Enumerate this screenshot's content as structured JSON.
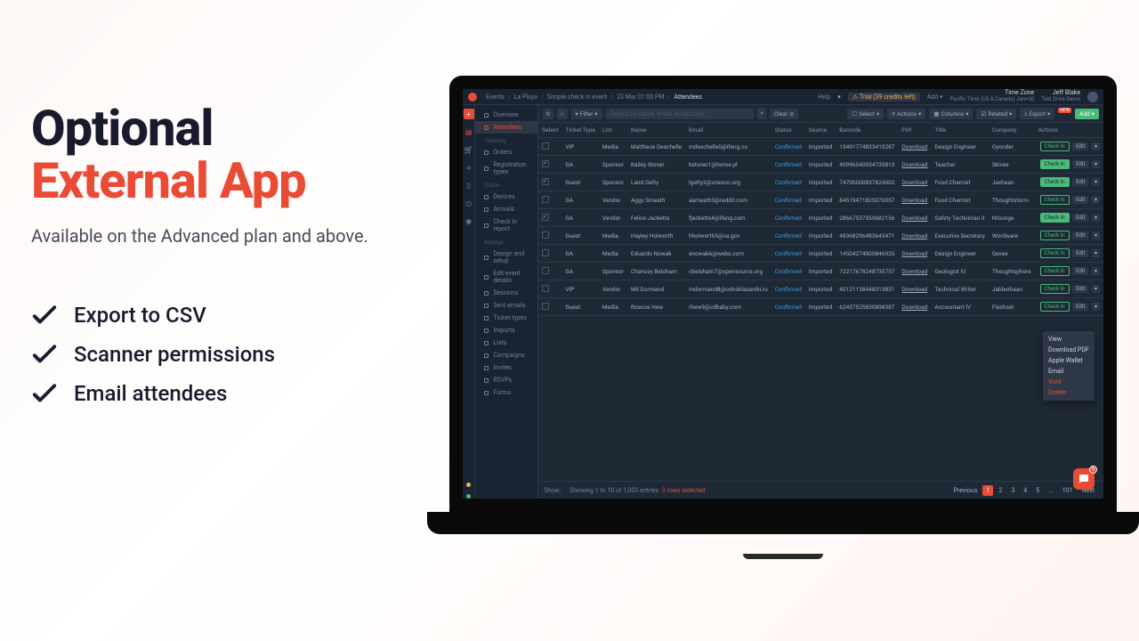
{
  "marketing": {
    "heading1": "Optional",
    "heading2": "External App",
    "subline": "Available on the Advanced plan and above.",
    "features": [
      "Export to CSV",
      "Scanner permissions",
      "Email attendees"
    ]
  },
  "breadcrumb": [
    "Events",
    "La Playa",
    "Simple check in event",
    "23 Mar 01:00 PM",
    "Attendees"
  ],
  "topbar": {
    "help": "Help",
    "trial": "Trial (39 credits left)",
    "add": "Add",
    "tz_label": "Time Zone",
    "tz_value": "Pacific Time (US & Canada)  Jan+00",
    "user_name": "Jeff Blake",
    "user_sub": "Test Drive Demo"
  },
  "sidebar": {
    "items": [
      {
        "label": "Overview"
      },
      {
        "label": "Attendees",
        "active": true
      }
    ],
    "sections": [
      {
        "header": "Ticketing",
        "items": [
          "Orders",
          "Registration types"
        ]
      },
      {
        "header": "Onsite",
        "items": [
          "Devices",
          "Arrivals",
          "Check in report"
        ]
      },
      {
        "header": "Manage",
        "items": [
          "Design and setup",
          "Edit event details",
          "Sessions",
          "Sent emails",
          "Ticket types",
          "Imports",
          "Lists",
          "Campaigns",
          "Invites",
          "RSVPs",
          "Forms"
        ]
      }
    ]
  },
  "toolbar": {
    "filter": "Filter",
    "search_placeholder": "Search by name, email or barcode...",
    "clear": "Clear",
    "select": "Select",
    "actions": "Actions",
    "columns": "Columns",
    "related": "Related",
    "export": "Export",
    "new": "NEW",
    "add": "Add"
  },
  "columns": [
    "Select",
    "Ticket Type",
    "List",
    "Name",
    "Email",
    "Status",
    "Source",
    "Barcode",
    "PDF",
    "Title",
    "Company",
    "Actions"
  ],
  "rows": [
    {
      "sel": false,
      "ticket": "VIP",
      "list": "Media",
      "name": "Mattheus Deschelle",
      "email": "mdeschelle0@ifeng.co",
      "status": "Confirmed",
      "source": "Imported",
      "barcode": "13491774833410287",
      "pdf": "Download",
      "title": "Design Engineer",
      "company": "Oyonder",
      "checkin_filled": false
    },
    {
      "sel": true,
      "ticket": "GA",
      "list": "Sponsor",
      "name": "Kailey Stoner",
      "email": "kstoner1@home.pl",
      "status": "Confirmed",
      "source": "Imported",
      "barcode": "40996540054735813",
      "pdf": "Download",
      "title": "Teacher",
      "company": "Skivee",
      "checkin_filled": true
    },
    {
      "sel": true,
      "ticket": "Guest",
      "list": "Sponsor",
      "name": "Laird Getty",
      "email": "lgetty2@unesco.org",
      "status": "Confirmed",
      "source": "Imported",
      "barcode": "74700000837824002",
      "pdf": "Download",
      "title": "Food Chemist",
      "company": "Jaxbean",
      "checkin_filled": true
    },
    {
      "sel": false,
      "ticket": "GA",
      "list": "Vendor",
      "name": "Aggy Smeath",
      "email": "asmeath3@reddit.com",
      "status": "Confirmed",
      "source": "Imported",
      "barcode": "84519471825070057",
      "pdf": "Download",
      "title": "Food Chemist",
      "company": "Thoughtstorm",
      "checkin_filled": false
    },
    {
      "sel": true,
      "ticket": "GA",
      "list": "Vendor",
      "name": "Felice Jacketts",
      "email": "fjacketts4@ifeng.com",
      "status": "Confirmed",
      "source": "Imported",
      "barcode": "28667537359682156",
      "pdf": "Download",
      "title": "Safety Technician II",
      "company": "Ntounge",
      "checkin_filled": true
    },
    {
      "sel": false,
      "ticket": "Guest",
      "list": "Media",
      "name": "Hayley Holworth",
      "email": "hholworth5@va.gov",
      "status": "Confirmed",
      "source": "Imported",
      "barcode": "48368296483645471",
      "pdf": "Download",
      "title": "Executive Secretary",
      "company": "Wordware",
      "checkin_filled": false
    },
    {
      "sel": false,
      "ticket": "GA",
      "list": "Media",
      "name": "Eduardo Nowak",
      "email": "enowak6@webs.com",
      "status": "Confirmed",
      "source": "Imported",
      "barcode": "14504274000846925",
      "pdf": "Download",
      "title": "Design Engineer",
      "company": "Gevee",
      "checkin_filled": false
    },
    {
      "sel": false,
      "ticket": "GA",
      "list": "Sponsor",
      "name": "Chancey Belsham",
      "email": "cbelsham7@opensource.org",
      "status": "Confirmed",
      "source": "Imported",
      "barcode": "72217678248735757",
      "pdf": "Download",
      "title": "Geologist IV",
      "company": "Thoughtsphere",
      "checkin_filled": false
    },
    {
      "sel": false,
      "ticket": "VIP",
      "list": "Vendor",
      "name": "Mil Dormand",
      "email": "mdormand8@odnoklassniki.ru",
      "status": "Confirmed",
      "source": "Imported",
      "barcode": "40121138448313831",
      "pdf": "Download",
      "title": "Technical Writer",
      "company": "Jabberbean",
      "checkin_filled": false
    },
    {
      "sel": false,
      "ticket": "Guest",
      "list": "Media",
      "name": "Roscoe Hew",
      "email": "rhew9@cdbaby.com",
      "status": "Confirmed",
      "source": "Imported",
      "barcode": "62457525830898387",
      "pdf": "Download",
      "title": "Accountant IV",
      "company": "Flashset",
      "checkin_filled": false
    }
  ],
  "row_actions": {
    "check_in": "Check In",
    "edit": "Edit"
  },
  "dropdown": [
    "View",
    "Download PDF",
    "Apple Wallet",
    "Email",
    "Void",
    "Delete"
  ],
  "footer": {
    "show": "Show:",
    "info": "Showing 1 to 10 of 1,003 entries",
    "selected": "3 rows selected",
    "prev": "Previous",
    "pages": [
      "1",
      "2",
      "3",
      "4",
      "5",
      "...",
      "101"
    ],
    "next": "Next"
  },
  "chat_notif": "9"
}
